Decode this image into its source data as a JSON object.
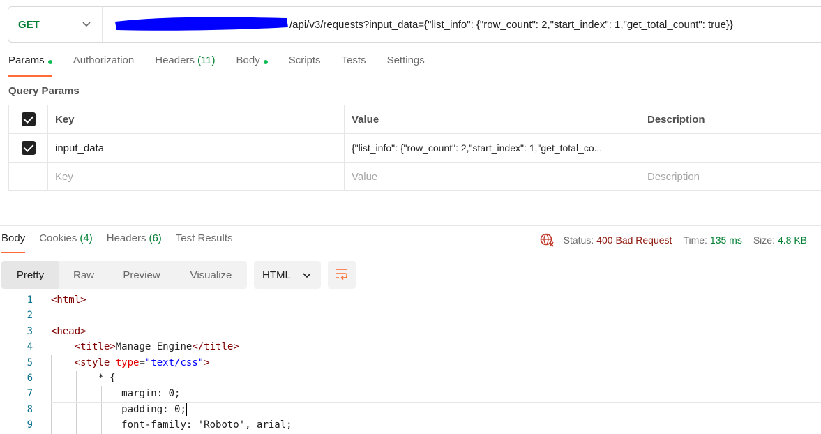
{
  "request": {
    "method": "GET",
    "url_visible": "/api/v3/requests?input_data={\"list_info\": {\"row_count\": 2,\"start_index\": 1,\"get_total_count\": true}}"
  },
  "request_tabs": [
    {
      "label": "Params",
      "dot": true,
      "active": true
    },
    {
      "label": "Authorization"
    },
    {
      "label": "Headers",
      "count": "(11)"
    },
    {
      "label": "Body",
      "dot": true
    },
    {
      "label": "Scripts"
    },
    {
      "label": "Tests"
    },
    {
      "label": "Settings"
    }
  ],
  "query_params": {
    "title": "Query Params",
    "columns": {
      "key": "Key",
      "value": "Value",
      "description": "Description"
    },
    "rows": [
      {
        "checked": true,
        "key": "input_data",
        "value": "{\"list_info\": {\"row_count\": 2,\"start_index\": 1,\"get_total_co...",
        "description": ""
      }
    ],
    "placeholder": {
      "key": "Key",
      "value": "Value",
      "description": "Description"
    }
  },
  "response_tabs": [
    {
      "label": "Body",
      "active": true
    },
    {
      "label": "Cookies",
      "count": "(4)"
    },
    {
      "label": "Headers",
      "count": "(6)"
    },
    {
      "label": "Test Results"
    }
  ],
  "status": {
    "status_label": "Status:",
    "status_value": "400 Bad Request",
    "time_label": "Time:",
    "time_value": "135 ms",
    "size_label": "Size:",
    "size_value": "4.8 KB"
  },
  "view_modes": [
    "Pretty",
    "Raw",
    "Preview",
    "Visualize"
  ],
  "active_view_mode": "Pretty",
  "format": "HTML",
  "code_lines": [
    {
      "n": "1",
      "parts": [
        [
          "tg",
          "<html>"
        ]
      ]
    },
    {
      "n": "2",
      "parts": []
    },
    {
      "n": "3",
      "parts": [
        [
          "tg",
          "<head>"
        ]
      ]
    },
    {
      "n": "4",
      "indent": "    ",
      "parts": [
        [
          "tg",
          "<title>"
        ],
        [
          "",
          "Manage Engine"
        ],
        [
          "tg",
          "</title>"
        ]
      ]
    },
    {
      "n": "5",
      "indent": "    ",
      "parts": [
        [
          "tg",
          "<style "
        ],
        [
          "at",
          "type"
        ],
        [
          "",
          "="
        ],
        [
          "st",
          "\"text/css\""
        ],
        [
          "tg",
          ">"
        ]
      ]
    },
    {
      "n": "6",
      "indent": "        ",
      "parts": [
        [
          "",
          "* {"
        ]
      ]
    },
    {
      "n": "7",
      "indent": "            ",
      "parts": [
        [
          "",
          "margin: 0;"
        ]
      ]
    },
    {
      "n": "8",
      "indent": "            ",
      "parts": [
        [
          "",
          "padding: 0;"
        ]
      ],
      "cursor": true
    },
    {
      "n": "9",
      "indent": "            ",
      "parts": [
        [
          "",
          "font-family: "
        ],
        [
          "",
          "'Roboto', arial;"
        ]
      ]
    }
  ],
  "colors": {
    "accent": "#ff6c37",
    "method": "#007f31",
    "error": "#8e1a10",
    "success": "#007f31"
  }
}
